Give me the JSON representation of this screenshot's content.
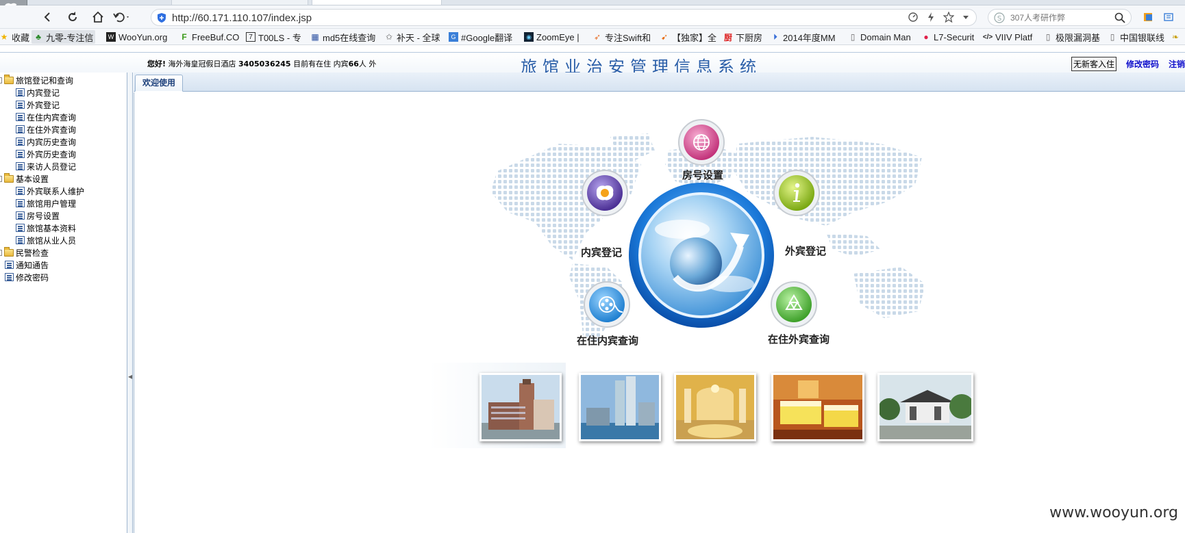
{
  "browser": {
    "url": "http://60.171.110.107/index.jsp",
    "search_placeholder": "307人考研作弊",
    "bookmarks": [
      {
        "label": "收藏",
        "icon": "star-icon"
      },
      {
        "label": "九零-专注信",
        "icon": "runner-icon",
        "active": true
      },
      {
        "label": "WooYun.org",
        "icon": "wooyun-icon"
      },
      {
        "label": "FreeBuf.CO",
        "icon": "freebuf-icon"
      },
      {
        "label": "T00LS - 专",
        "icon": "tools-icon"
      },
      {
        "label": "md5在线查询",
        "icon": "grid-icon"
      },
      {
        "label": "补天 - 全球",
        "icon": "butian-icon"
      },
      {
        "label": "#Google翻译",
        "icon": "translate-icon"
      },
      {
        "label": "ZoomEye |",
        "icon": "zoomeye-icon"
      },
      {
        "label": "专注Swift和",
        "icon": "swift-icon"
      },
      {
        "label": "【独家】全",
        "icon": "bird-icon"
      },
      {
        "label": "下厨房",
        "icon": "kitchen-icon"
      },
      {
        "label": "2014年度MM",
        "icon": "play-icon"
      },
      {
        "label": "Domain Man",
        "icon": "page-icon"
      },
      {
        "label": "L7-Securit",
        "icon": "l7-icon"
      },
      {
        "label": "VIIV Platf",
        "icon": "code-icon"
      },
      {
        "label": "极限漏洞基",
        "icon": "page-icon"
      },
      {
        "label": "中国银联线",
        "icon": "page-icon"
      }
    ]
  },
  "header": {
    "greeting_hello": "您好!",
    "hotel_name": "海外海皇冠假日酒店",
    "hotel_code": "3405036245",
    "present_prefix": "目前有在住",
    "domestic_label": "内宾",
    "domestic_count": "66",
    "domestic_unit": "人",
    "foreign_label": "外",
    "system_title": "旅馆业治安管理信息系统",
    "no_guest_button": "无新客入住",
    "change_password": "修改密码",
    "logout": "注销"
  },
  "tree": {
    "groups": [
      {
        "label": "旅馆登记和查询",
        "items": [
          "内宾登记",
          "外宾登记",
          "在住内宾查询",
          "在住外宾查询",
          "内宾历史查询",
          "外宾历史查询",
          "来访人员登记"
        ]
      },
      {
        "label": "基本设置",
        "items": [
          "外宾联系人维护",
          "旅馆用户管理",
          "房号设置",
          "旅馆基本资料",
          "旅馆从业人员"
        ]
      },
      {
        "label": "民警检查",
        "items": []
      }
    ],
    "root_items": [
      "通知通告",
      "修改密码"
    ]
  },
  "tabs": {
    "welcome": "欢迎使用"
  },
  "dashboard": {
    "room_setup": "房号设置",
    "domestic_register": "内宾登记",
    "foreign_register": "外宾登记",
    "domestic_query": "在住内宾查询",
    "foreign_query": "在住外宾查询"
  },
  "colors": {
    "title_blue": "#2a5ea8",
    "link_blue": "#1010cc",
    "orb_pink": "#c2327a",
    "orb_purple": "#5a3f9e",
    "orb_green": "#8cbf1d",
    "orb_blue": "#1f7fd0",
    "orb_recycle": "#3ea02a"
  },
  "watermark": "www.wooyun.org"
}
